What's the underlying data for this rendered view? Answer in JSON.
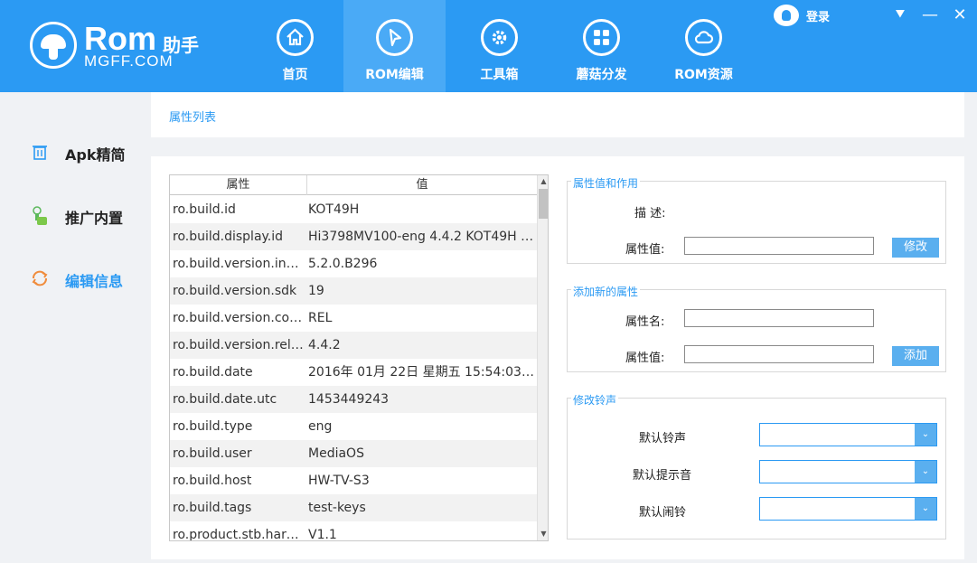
{
  "app": {
    "logo_text": "Rom",
    "logo_cn": "助手",
    "logo_site": "MGFF.COM"
  },
  "nav": {
    "items": [
      {
        "label": "首页",
        "icon": "home-icon"
      },
      {
        "label": "ROM编辑",
        "icon": "cursor-icon",
        "active": true
      },
      {
        "label": "工具箱",
        "icon": "gear-icon"
      },
      {
        "label": "蘑菇分发",
        "icon": "grid-icon"
      },
      {
        "label": "ROM资源",
        "icon": "cloud-icon"
      }
    ]
  },
  "header_right": {
    "login_label": "登录",
    "menu_glyph": "⯆",
    "min_glyph": "—",
    "close_glyph": "✕"
  },
  "sidebar": {
    "items": [
      {
        "label": "Apk精简",
        "icon": "trash-icon"
      },
      {
        "label": "推广内置",
        "icon": "hand-icon"
      },
      {
        "label": "编辑信息",
        "icon": "refresh-icon",
        "active": true
      }
    ]
  },
  "tab": {
    "title": "属性列表"
  },
  "table": {
    "col_key": "属性",
    "col_value": "值",
    "rows": [
      {
        "k": "ro.build.id",
        "v": "KOT49H"
      },
      {
        "k": "ro.build.display.id",
        "v": "Hi3798MV100-eng 4.4.2 KOT49H en..."
      },
      {
        "k": "ro.build.version.incr...",
        "v": "5.2.0.B296"
      },
      {
        "k": "ro.build.version.sdk",
        "v": "19"
      },
      {
        "k": "ro.build.version.cod...",
        "v": "REL"
      },
      {
        "k": "ro.build.version.rele...",
        "v": "4.4.2"
      },
      {
        "k": "ro.build.date",
        "v": "2016年 01月 22日 星期五 15:54:03 CST"
      },
      {
        "k": "ro.build.date.utc",
        "v": "1453449243"
      },
      {
        "k": "ro.build.type",
        "v": "eng"
      },
      {
        "k": "ro.build.user",
        "v": "MediaOS"
      },
      {
        "k": "ro.build.host",
        "v": "HW-TV-S3"
      },
      {
        "k": "ro.build.tags",
        "v": "test-keys"
      },
      {
        "k": "ro.product.stb.hard...",
        "v": "V1.1"
      }
    ]
  },
  "group_prop": {
    "title": "属性值和作用",
    "desc_label": "描 述:",
    "value_label": "属性值:",
    "value": "",
    "modify_button": "修改"
  },
  "group_add": {
    "title": "添加新的属性",
    "name_label": "属性名:",
    "name_value": "",
    "value_label": "属性值:",
    "value": "",
    "add_button": "添加"
  },
  "group_ring": {
    "title": "修改铃声",
    "ringtone_label": "默认铃声",
    "ringtone_value": "",
    "notify_label": "默认提示音",
    "notify_value": "",
    "alarm_label": "默认闹铃",
    "alarm_value": ""
  },
  "colors": {
    "accent": "#2b9af3",
    "header": "#2b9af3",
    "button": "#5aafef"
  }
}
